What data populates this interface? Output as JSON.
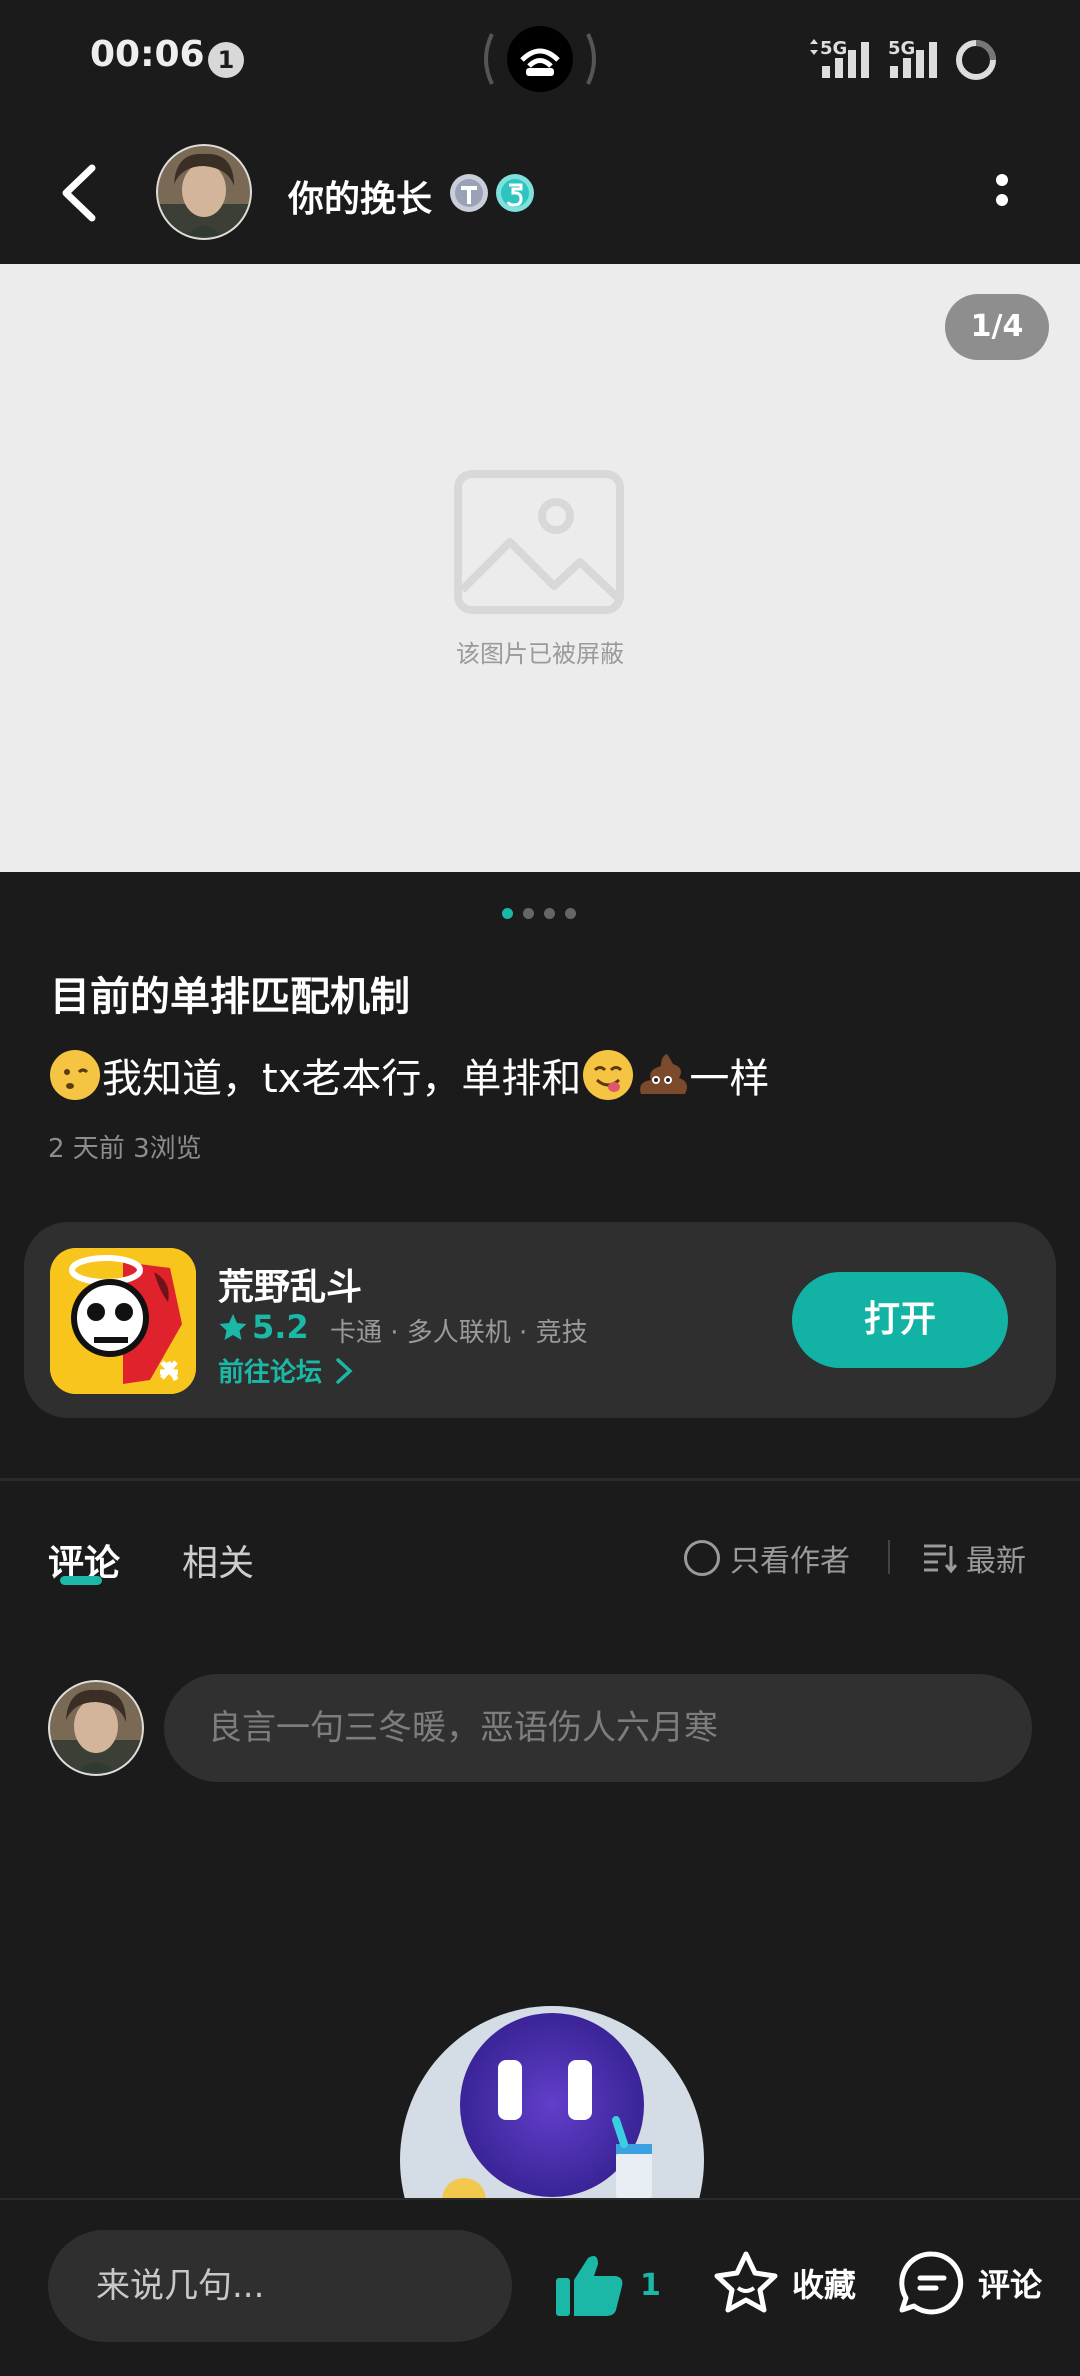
{
  "status_bar": {
    "time": "00:06",
    "notification_count": "1",
    "network_1": "5G",
    "network_2": "5G"
  },
  "header": {
    "author_name": "你的挽长"
  },
  "image_viewer": {
    "page_counter": "1/4",
    "blocked_text": "该图片已被屏蔽",
    "total_pages": 4,
    "current_page": 1
  },
  "post": {
    "title": "目前的单排匹配机制",
    "body_part1": "我知道，tx老本行，单排和",
    "body_part2": "一样",
    "meta": "2 天前  3浏览"
  },
  "game_card": {
    "name": "荒野乱斗",
    "rating": "5.2",
    "tags": "卡通 · 多人联机 · 竞技",
    "forum_link": "前往论坛",
    "open_label": "打开"
  },
  "comments_section": {
    "tab_comments": "评论",
    "tab_related": "相关",
    "author_only": "只看作者",
    "sort_latest": "最新",
    "input_placeholder": "良言一句三冬暖，恶语伤人六月寒"
  },
  "bottom_bar": {
    "quick_comment": "来说几句...",
    "like_count": "1",
    "favorite_label": "收藏",
    "comment_label": "评论"
  },
  "colors": {
    "accent": "#1bb8a8",
    "background": "#1b1b1b",
    "card": "#2f2f2f"
  }
}
